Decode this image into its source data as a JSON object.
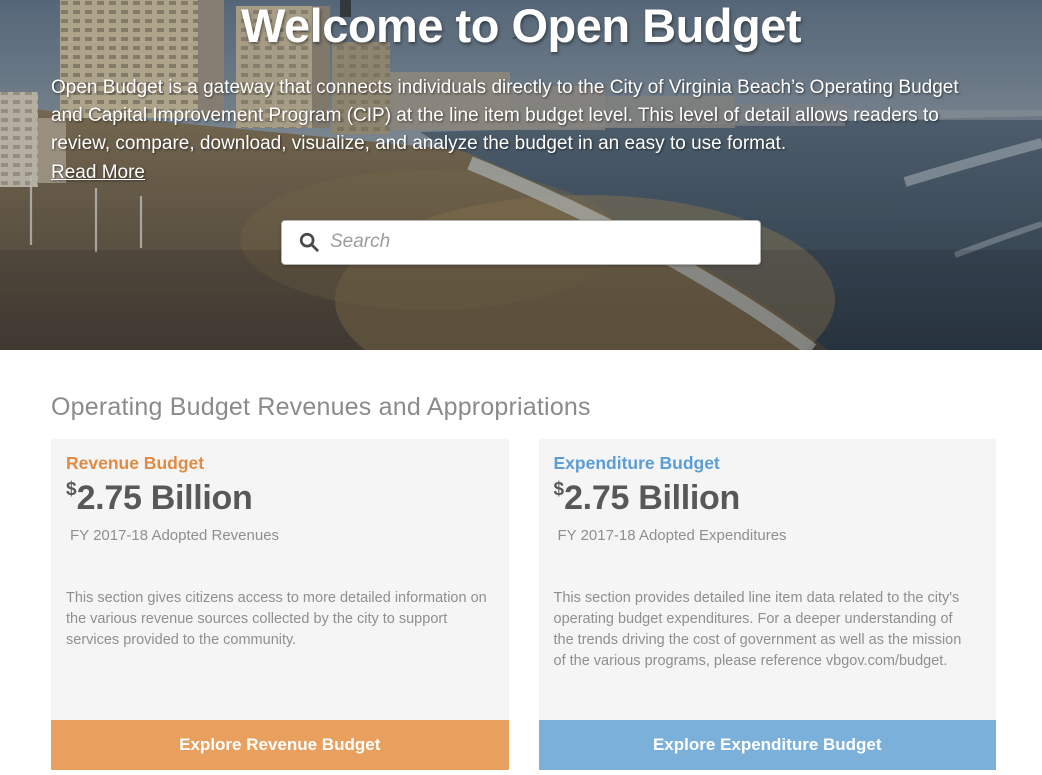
{
  "hero": {
    "title": "Welcome to Open Budget",
    "description": "Open Budget is a gateway that connects individuals directly to the City of Virginia Beach’s Operating Budget and Capital Improvement Program (CIP) at the line item budget level. This level of detail allows readers to review, compare, download, visualize, and analyze the budget in an easy to use format.",
    "read_more_label": "Read More",
    "search": {
      "placeholder": "Search",
      "icon": "magnifier"
    }
  },
  "main": {
    "section_title": "Operating Budget Revenues and Appropriations",
    "cards": [
      {
        "title": "Revenue Budget",
        "currency_symbol": "$",
        "amount": "2.75 Billion",
        "caption": "FY 2017-18 Adopted Revenues",
        "description": "This section gives citizens access to more detailed information on the various revenue sources collected by the city to support services provided to the community.",
        "button_label": "Explore Revenue Budget",
        "accent_color": "#e18b43",
        "button_color": "#e9a05e"
      },
      {
        "title": "Expenditure Budget",
        "currency_symbol": "$",
        "amount": "2.75 Billion",
        "caption": "FY 2017-18 Adopted Expenditures",
        "description": "This section provides detailed line item data related to the city's operating budget expenditures. For a deeper understanding of the trends driving the cost of government as well as the mission of the various programs, please reference vbgov.com/budget.",
        "button_label": "Explore Expenditure Budget",
        "accent_color": "#5b9ed6",
        "button_color": "#7bb0da"
      }
    ]
  },
  "colors": {
    "big_number": "#57585a",
    "muted_text": "#8f8f8f",
    "section_title": "#8b8b8b",
    "card_background": "#f5f5f5"
  }
}
